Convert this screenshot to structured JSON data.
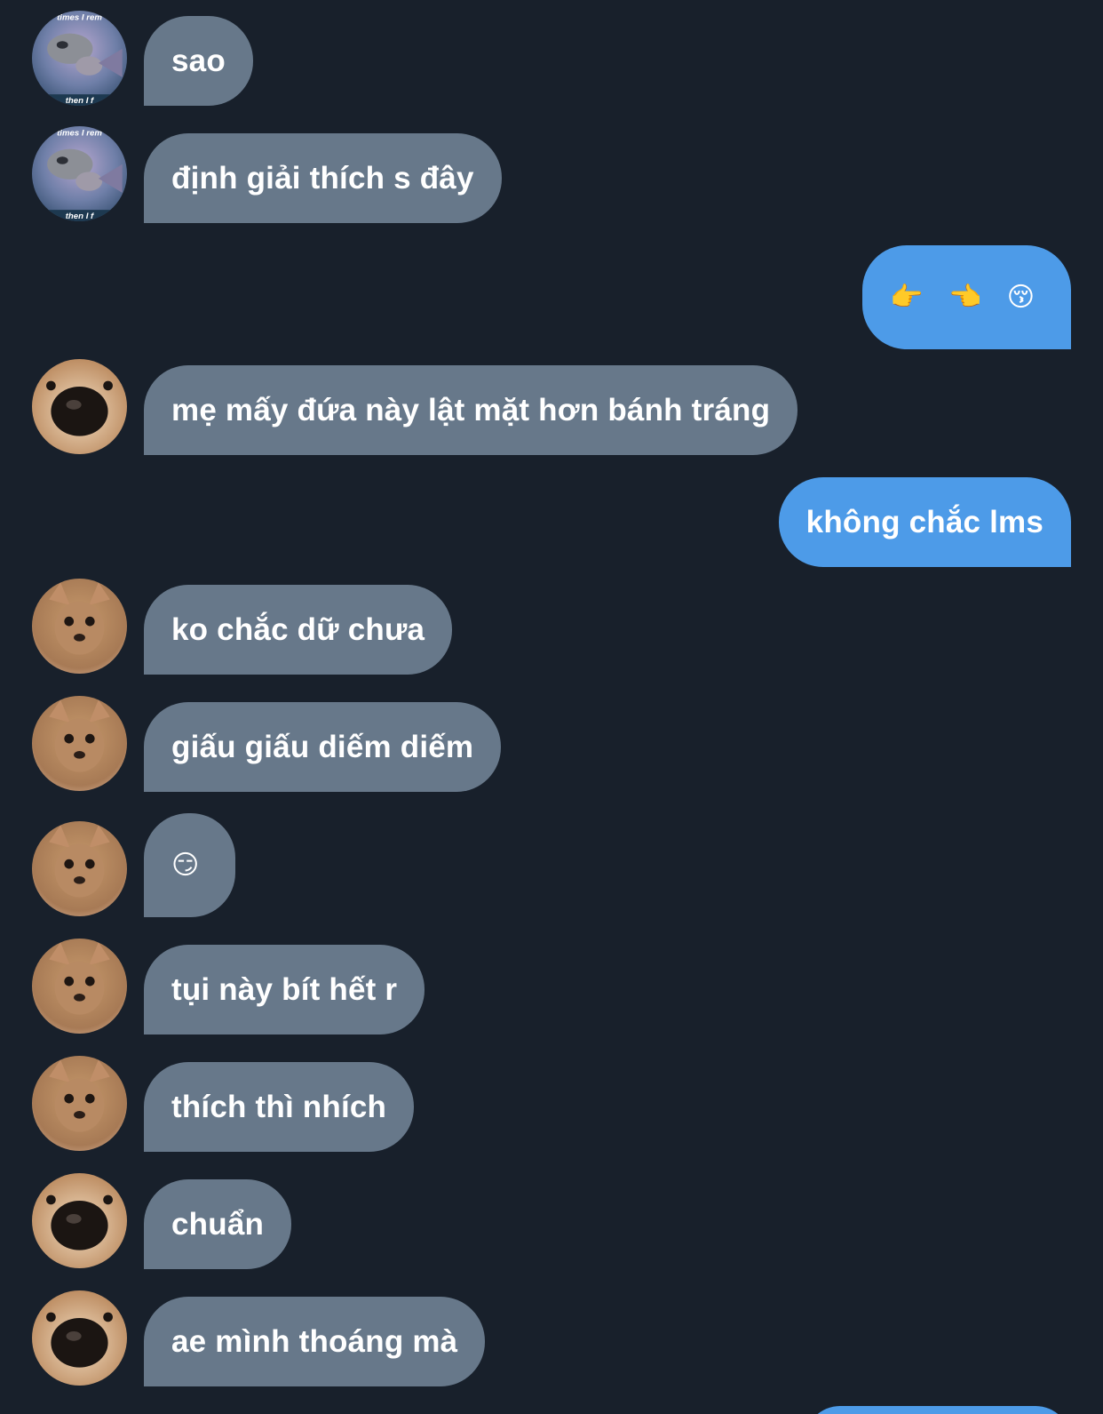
{
  "messages": [
    {
      "side": "in",
      "sender": "raccoon",
      "text": "sao"
    },
    {
      "side": "in",
      "sender": "raccoon",
      "text": "định giải thích s đây"
    },
    {
      "side": "out",
      "text": "👉 👈 😚"
    },
    {
      "side": "in",
      "sender": "dog-nose",
      "text": "mẹ mấy đứa này lật mặt hơn bánh tráng"
    },
    {
      "side": "out",
      "text": "không chắc lms"
    },
    {
      "side": "in",
      "sender": "chihuahua",
      "text": "ko chắc dữ chưa"
    },
    {
      "side": "in",
      "sender": "chihuahua",
      "text": "giấu giấu diếm diếm"
    },
    {
      "side": "in",
      "sender": "chihuahua",
      "text": "😏"
    },
    {
      "side": "in",
      "sender": "chihuahua",
      "text": "tụi này bít hết r"
    },
    {
      "side": "in",
      "sender": "chihuahua",
      "text": "thích thì nhích"
    },
    {
      "side": "in",
      "sender": "dog-nose",
      "text": "chuẩn"
    },
    {
      "side": "in",
      "sender": "dog-nose",
      "text": "ae mình thoáng mà"
    }
  ],
  "avatar_captions": {
    "raccoon_top": "times I rem",
    "raccoon_bottom": "then I f"
  },
  "colors": {
    "background": "#18202b",
    "incoming_bubble": "#67788a",
    "outgoing_bubble": "#4d9be8",
    "text": "#ffffff"
  }
}
